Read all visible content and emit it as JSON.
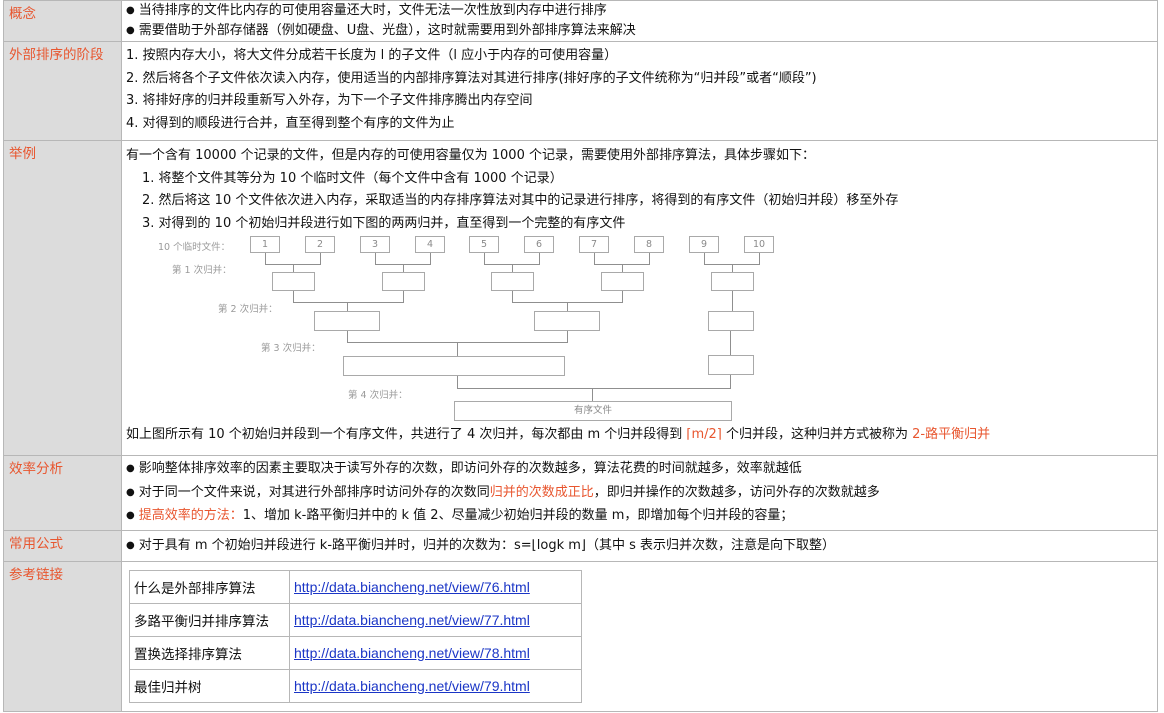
{
  "concept": {
    "label": "概念",
    "items": [
      "当待排序的文件比内存的可使用容量还大时，文件无法一次性放到内存中进行排序",
      "需要借助于外部存储器（例如硬盘、U盘、光盘），这时就需要用到外部排序算法来解决"
    ]
  },
  "stages": {
    "label": "外部排序的阶段",
    "items": [
      "1. 按照内存大小，将大文件分成若干长度为 l 的子文件（l 应小于内存的可使用容量）",
      "2. 然后将各个子文件依次读入内存，使用适当的内部排序算法对其进行排序(排好序的子文件统称为“归并段”或者“顺段”)",
      "3. 将排好序的归并段重新写入外存，为下一个子文件排序腾出内存空间",
      "4. 对得到的顺段进行合并，直至得到整个有序的文件为止"
    ]
  },
  "example": {
    "label": "举例",
    "intro": "有一个含有 10000 个记录的文件，但是内存的可使用容量仅为 1000 个记录，需要使用外部排序算法，具体步骤如下：",
    "steps": [
      "1. 将整个文件其等分为 10 个临时文件（每个文件中含有 1000 个记录）",
      "2. 然后将这 10 个文件依次进入内存，采取适当的内存排序算法对其中的记录进行排序，将得到的有序文件（初始归并段）移至外存",
      "3. 对得到的 10 个初始归并段进行如下图的两两归并，直至得到一个完整的有序文件"
    ],
    "diagram": {
      "temp_label": "10 个临时文件：",
      "round1": "第 1 次归并：",
      "round2": "第 2 次归并：",
      "round3": "第 3 次归并：",
      "round4": "第 4 次归并：",
      "files": [
        "1",
        "2",
        "3",
        "4",
        "5",
        "6",
        "7",
        "8",
        "9",
        "10"
      ],
      "final_label": "有序文件"
    },
    "summary_pre": "如上图所示有 10 个初始归并段到一个有序文件，共进行了 4 次归并，每次都由 m 个归并段得到 ",
    "summary_red1": "⌈m/2⌉",
    "summary_mid": " 个归并段，这种归并方式被称为 ",
    "summary_red2": "2-路平衡归并"
  },
  "efficiency": {
    "label": "效率分析",
    "item1": "影响整体排序效率的因素主要取决于读写外存的次数，即访问外存的次数越多，算法花费的时间就越多，效率就越低",
    "item2_pre": "对于同一个文件来说，对其进行外部排序时访问外存的次数同",
    "item2_red": "归并的次数成正比",
    "item2_post": "，即归并操作的次数越多，访问外存的次数就越多",
    "item3_red": "提高效率的方法：",
    "item3_post": "1、增加 k-路平衡归并中的 k 值 2、尽量减少初始归并段的数量 m，即增加每个归并段的容量；"
  },
  "formula": {
    "label": "常用公式",
    "text": "对于具有 m 个初始归并段进行 k-路平衡归并时，归并的次数为：s=⌊logk  m⌋（其中 s 表示归并次数，注意是向下取整）"
  },
  "refs": {
    "label": "参考链接",
    "links": [
      {
        "title": "什么是外部排序算法",
        "url": "http://data.biancheng.net/view/76.html"
      },
      {
        "title": "多路平衡归并排序算法",
        "url": "http://data.biancheng.net/view/77.html"
      },
      {
        "title": "置换选择排序算法",
        "url": "http://data.biancheng.net/view/78.html"
      },
      {
        "title": "最佳归并树",
        "url": "http://data.biancheng.net/view/79.html"
      }
    ]
  }
}
